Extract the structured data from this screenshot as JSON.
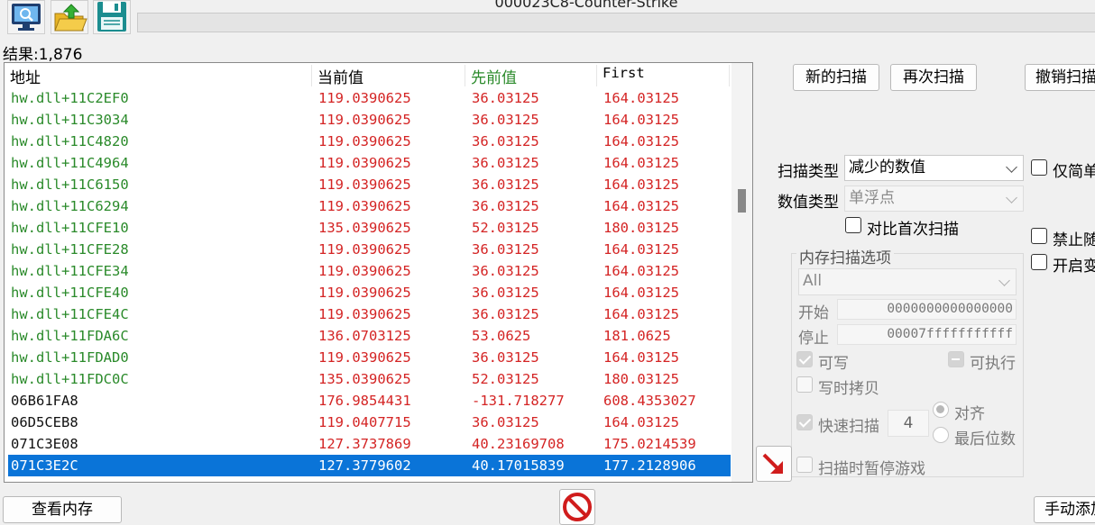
{
  "window": {
    "title": "000023C8-Counter-Strike"
  },
  "toolbar": {
    "icons": [
      "process-select-icon",
      "open-file-icon",
      "save-icon"
    ]
  },
  "results": {
    "label": "结果:1,876"
  },
  "columns": {
    "address": "地址",
    "current": "当前值",
    "previous": "先前值",
    "first": "First",
    "previous_color": "#2a8a2a"
  },
  "rows": [
    {
      "address": "hw.dll+11C2EF0",
      "current": "119.0390625",
      "previous": "36.03125",
      "first": "164.03125",
      "type": "green"
    },
    {
      "address": "hw.dll+11C3034",
      "current": "119.0390625",
      "previous": "36.03125",
      "first": "164.03125",
      "type": "green"
    },
    {
      "address": "hw.dll+11C4820",
      "current": "119.0390625",
      "previous": "36.03125",
      "first": "164.03125",
      "type": "green"
    },
    {
      "address": "hw.dll+11C4964",
      "current": "119.0390625",
      "previous": "36.03125",
      "first": "164.03125",
      "type": "green"
    },
    {
      "address": "hw.dll+11C6150",
      "current": "119.0390625",
      "previous": "36.03125",
      "first": "164.03125",
      "type": "green"
    },
    {
      "address": "hw.dll+11C6294",
      "current": "119.0390625",
      "previous": "36.03125",
      "first": "164.03125",
      "type": "green"
    },
    {
      "address": "hw.dll+11CFE10",
      "current": "135.0390625",
      "previous": "52.03125",
      "first": "180.03125",
      "type": "green"
    },
    {
      "address": "hw.dll+11CFE28",
      "current": "119.0390625",
      "previous": "36.03125",
      "first": "164.03125",
      "type": "green"
    },
    {
      "address": "hw.dll+11CFE34",
      "current": "119.0390625",
      "previous": "36.03125",
      "first": "164.03125",
      "type": "green"
    },
    {
      "address": "hw.dll+11CFE40",
      "current": "119.0390625",
      "previous": "36.03125",
      "first": "164.03125",
      "type": "green"
    },
    {
      "address": "hw.dll+11CFE4C",
      "current": "119.0390625",
      "previous": "36.03125",
      "first": "164.03125",
      "type": "green"
    },
    {
      "address": "hw.dll+11FDA6C",
      "current": "136.0703125",
      "previous": "53.0625",
      "first": "181.0625",
      "type": "green"
    },
    {
      "address": "hw.dll+11FDAD0",
      "current": "119.0390625",
      "previous": "36.03125",
      "first": "164.03125",
      "type": "green"
    },
    {
      "address": "hw.dll+11FDC0C",
      "current": "135.0390625",
      "previous": "52.03125",
      "first": "180.03125",
      "type": "green"
    },
    {
      "address": "06B61FA8",
      "current": "176.9854431",
      "previous": "-131.718277",
      "first": "608.4353027",
      "type": "black"
    },
    {
      "address": "06D5CEB8",
      "current": "119.0407715",
      "previous": "36.03125",
      "first": "164.03125",
      "type": "black"
    },
    {
      "address": "071C3E08",
      "current": "127.3737869",
      "previous": "40.23169708",
      "first": "175.0214539",
      "type": "black"
    },
    {
      "address": "071C3E2C",
      "current": "127.3779602",
      "previous": "40.17015839",
      "first": "177.2128906",
      "type": "selected"
    }
  ],
  "buttons": {
    "new_scan": "新的扫描",
    "next_scan": "再次扫描",
    "undo_scan": "撤销扫描",
    "view_memory": "查看内存",
    "add_address": "手动添加"
  },
  "scan": {
    "scan_type_label": "扫描类型",
    "scan_type_value": "减少的数值",
    "value_type_label": "数值类型",
    "value_type_value": "单浮点",
    "compare_first": "对比首次扫描",
    "simple_values_only": "仅简单值",
    "disable_random": "禁止随机",
    "enable_speedhack": "开启变速"
  },
  "memory_options": {
    "title": "内存扫描选项",
    "region": "All",
    "start_label": "开始",
    "start_value": "0000000000000000",
    "stop_label": "停止",
    "stop_value": "00007fffffffffff",
    "writable": "可写",
    "executable": "可执行",
    "copy_on_write": "写时拷贝",
    "fast_scan": "快速扫描",
    "fast_scan_value": "4",
    "alignment": "对齐",
    "last_digits": "最后位数",
    "pause_game": "扫描时暂停游戏"
  },
  "colors": {
    "green": "#2a8a2a",
    "red": "#d42424",
    "selection": "#0a74d8"
  }
}
